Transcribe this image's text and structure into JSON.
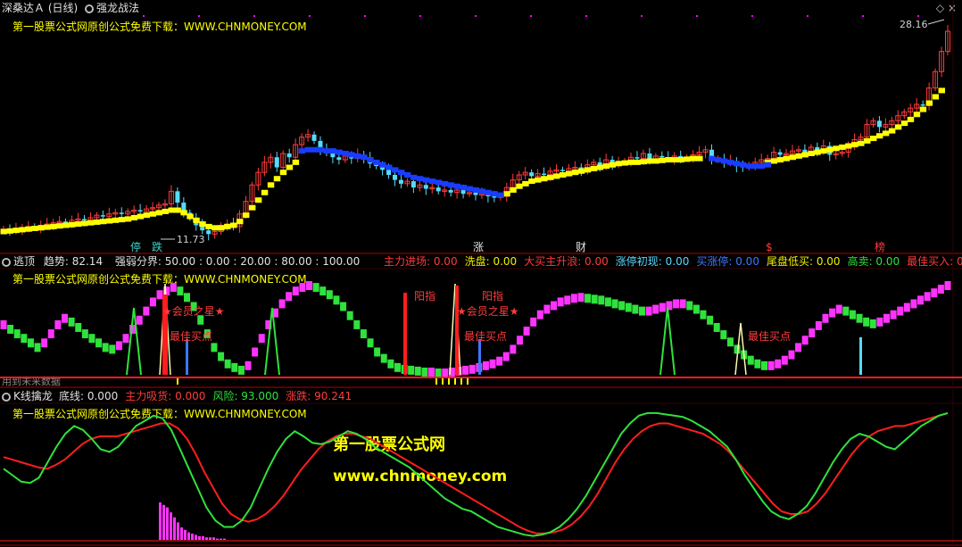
{
  "header": {
    "stock_name": "深桑达Ａ",
    "period": "(日线)",
    "indicator": "强龙战法",
    "ad_text": "第一股票公式网原创公式免费下载：WWW.CHNMONEY.COM",
    "high_label": "28.16",
    "low_label": "11.73"
  },
  "signal_labels": {
    "ting": "停",
    "die": "跌",
    "zhang": "涨",
    "cai": "财",
    "dollar": "$",
    "bang": "榜"
  },
  "panel2": {
    "name": "逃顶",
    "trend_label": "趋势:",
    "trend_value": "82.14",
    "boundary_label": "强弱分界:",
    "boundary_values": "50.00 : 0.00 : 20.00 : 80.00 : 100.00",
    "ad_text": "第一股票公式网原创公式免费下载：WWW.CHNMONEY.COM",
    "future_note": "用到未来数据",
    "annotations": {
      "yangzhi": "阳指",
      "member_star": "★会员之星★",
      "best_buy": "最佳买点"
    },
    "legend": [
      {
        "label": "主力进场:",
        "value": "0.00",
        "color": "#ff3c3c"
      },
      {
        "label": "洗盘:",
        "value": "0.00",
        "color": "#f0f000"
      },
      {
        "label": "大买主升浪:",
        "value": "0.00",
        "color": "#ff3c3c"
      },
      {
        "label": "涨停初现:",
        "value": "0.00",
        "color": "#57d8ff"
      },
      {
        "label": "买涨停:",
        "value": "0.00",
        "color": "#3c78ff"
      },
      {
        "label": "尾盘低买:",
        "value": "0.00",
        "color": "#f0f000"
      },
      {
        "label": "高卖:",
        "value": "0.00",
        "color": "#2fe23c"
      },
      {
        "label": "最佳买入:",
        "value": "0.00",
        "color": "#ff3c3c"
      }
    ]
  },
  "panel3": {
    "name": "K线擒龙",
    "legend": [
      {
        "label": "底线:",
        "value": "0.000",
        "color": "#e0e0e0"
      },
      {
        "label": "主力吸货:",
        "value": "0.000",
        "color": "#ff3c3c"
      },
      {
        "label": "风险:",
        "value": "93.000",
        "color": "#2fe23c"
      },
      {
        "label": "涨跌:",
        "value": "90.241",
        "color": "#ff3c3c"
      }
    ],
    "ad_text": "第一股票公式网原创公式免费下载：WWW.CHNMONEY.COM"
  },
  "watermark": {
    "title": "第一股票公式网",
    "url": "www.chnmoney.com"
  },
  "colors": {
    "up": "#ff3c3c",
    "down": "#54dcff",
    "yellow": "#ffff00",
    "blue": "#1a3cff",
    "green": "#2fe23c",
    "magenta": "#ff33ff",
    "red_line": "#ff1e1e",
    "panel_border": "#b00000"
  },
  "chart_data": [
    {
      "type": "candlestick",
      "price_markers": {
        "high": 28.16,
        "low": 11.73
      },
      "overlay_series": [
        {
          "values_key": "yellow_line"
        },
        {
          "values_key": "blue_line"
        }
      ],
      "close": [
        12.3,
        12.2,
        12.3,
        12.4,
        12.5,
        12.4,
        12.6,
        12.7,
        12.8,
        12.9,
        12.8,
        13.0,
        13.1,
        13.0,
        13.2,
        13.4,
        13.3,
        13.5,
        13.6,
        13.5,
        13.7,
        13.8,
        13.7,
        13.9,
        14.0,
        14.2,
        14.3,
        15.3,
        14.4,
        13.6,
        13.2,
        12.6,
        12.2,
        11.9,
        12.1,
        12.6,
        12.7,
        12.5,
        13.5,
        14.5,
        15.8,
        16.8,
        17.6,
        18.0,
        17.2,
        18.3,
        18.0,
        19.0,
        19.6,
        19.8,
        19.3,
        18.6,
        18.4,
        18.0,
        17.8,
        18.1,
        17.9,
        18.2,
        18.0,
        17.5,
        17.3,
        17.0,
        16.6,
        16.2,
        15.9,
        16.1,
        15.6,
        15.8,
        15.5,
        15.6,
        15.3,
        15.4,
        15.2,
        15.4,
        15.1,
        15.2,
        15.0,
        15.1,
        14.9,
        14.8,
        14.9,
        15.6,
        16.2,
        16.6,
        16.8,
        16.5,
        16.7,
        16.6,
        16.9,
        17.0,
        16.9,
        17.1,
        17.2,
        17.0,
        17.4,
        17.6,
        17.3,
        17.8,
        17.5,
        17.6,
        17.7,
        18.0,
        17.9,
        18.3,
        17.8,
        18.1,
        18.0,
        17.9,
        18.1,
        17.9,
        18.0,
        18.2,
        18.4,
        18.6,
        17.8,
        17.9,
        17.6,
        17.7,
        17.3,
        17.2,
        17.4,
        17.6,
        17.8,
        17.9,
        18.4,
        18.2,
        18.3,
        18.5,
        18.6,
        18.4,
        18.8,
        18.5,
        18.9,
        18.2,
        18.3,
        18.4,
        18.9,
        19.4,
        19.6,
        20.6,
        20.9,
        20.4,
        20.6,
        20.9,
        21.3,
        21.6,
        21.9,
        22.2,
        22.1,
        23.5,
        24.8,
        26.4,
        28.0
      ],
      "yellow_line": [
        12.1,
        12.15,
        12.2,
        12.25,
        12.3,
        12.35,
        12.4,
        12.45,
        12.5,
        12.55,
        12.6,
        12.65,
        12.7,
        12.75,
        12.8,
        12.85,
        12.9,
        12.95,
        13.0,
        13.05,
        13.1,
        13.2,
        13.3,
        13.4,
        13.5,
        13.6,
        13.7,
        13.8,
        13.8,
        13.6,
        13.3,
        13.0,
        12.7,
        12.5,
        12.4,
        12.4,
        12.5,
        12.6,
        12.9,
        13.4,
        14.0,
        14.6,
        15.2,
        15.8,
        16.3,
        16.8,
        17.2,
        17.6,
        null,
        null,
        null,
        null,
        null,
        null,
        null,
        null,
        null,
        null,
        null,
        null,
        null,
        null,
        null,
        null,
        null,
        null,
        null,
        null,
        null,
        null,
        null,
        null,
        null,
        null,
        null,
        null,
        null,
        null,
        null,
        null,
        null,
        15.1,
        15.4,
        15.7,
        15.9,
        16.1,
        16.2,
        16.3,
        16.4,
        16.5,
        16.6,
        16.7,
        16.8,
        16.9,
        17.0,
        17.1,
        17.2,
        17.3,
        17.4,
        17.5,
        17.55,
        17.6,
        17.6,
        17.65,
        17.7,
        17.7,
        17.75,
        17.8,
        17.8,
        17.8,
        17.85,
        17.9,
        17.9,
        null,
        null,
        null,
        null,
        null,
        null,
        null,
        null,
        null,
        null,
        17.6,
        17.7,
        17.8,
        17.9,
        18.0,
        18.1,
        18.2,
        18.3,
        18.4,
        18.5,
        18.6,
        18.7,
        18.8,
        18.9,
        19.0,
        19.1,
        19.3,
        19.5,
        19.7,
        19.9,
        20.1,
        20.4,
        20.7,
        21.0,
        21.4,
        21.8,
        22.3,
        22.8,
        23.3
      ],
      "blue_line": [
        null,
        null,
        null,
        null,
        null,
        null,
        null,
        null,
        null,
        null,
        null,
        null,
        null,
        null,
        null,
        null,
        null,
        null,
        null,
        null,
        null,
        null,
        null,
        null,
        null,
        null,
        null,
        null,
        null,
        null,
        null,
        null,
        null,
        null,
        null,
        null,
        null,
        null,
        null,
        null,
        null,
        null,
        null,
        null,
        null,
        null,
        null,
        null,
        18.5,
        18.6,
        18.6,
        18.6,
        18.5,
        18.5,
        18.4,
        18.3,
        18.2,
        18.1,
        18.0,
        17.8,
        17.6,
        17.4,
        17.2,
        17.0,
        16.8,
        16.6,
        16.4,
        16.3,
        16.2,
        16.1,
        16.0,
        15.9,
        15.8,
        15.7,
        15.6,
        15.5,
        15.4,
        15.3,
        15.2,
        15.1,
        15.0,
        null,
        null,
        null,
        null,
        null,
        null,
        null,
        null,
        null,
        null,
        null,
        null,
        null,
        null,
        null,
        null,
        null,
        null,
        null,
        null,
        null,
        null,
        null,
        null,
        null,
        null,
        null,
        null,
        null,
        null,
        null,
        null,
        null,
        17.9,
        17.8,
        17.7,
        17.6,
        17.5,
        17.4,
        17.3,
        17.3,
        17.3,
        17.4,
        null,
        null,
        null,
        null,
        null,
        null,
        null,
        null,
        null,
        null,
        null,
        null,
        null,
        null,
        null,
        null,
        null,
        null,
        null,
        null,
        null,
        null,
        null,
        null,
        null,
        null,
        null,
        null,
        null,
        null
      ]
    },
    {
      "type": "bar",
      "ylim": [
        0,
        100
      ],
      "trend_value": 82.14,
      "boundary_levels": [
        50,
        0,
        20,
        80,
        100
      ]
    },
    {
      "type": "line",
      "series": [
        {
          "name": "风险",
          "color": "#2fe23c",
          "value": 93.0
        },
        {
          "name": "涨跌",
          "color": "#ff1e1e",
          "value": 90.241
        }
      ],
      "ylim": [
        0,
        100
      ]
    }
  ]
}
